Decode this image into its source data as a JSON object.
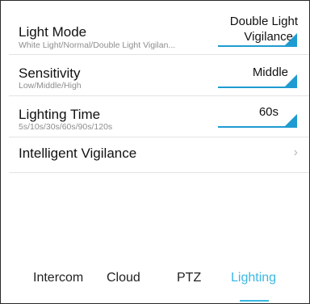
{
  "settings": {
    "light_mode": {
      "title": "Light Mode",
      "subtitle": "White Light/Normal/Double Light Vigilan...",
      "value_line1": "Double Light",
      "value_line2": "Vigilance"
    },
    "sensitivity": {
      "title": "Sensitivity",
      "subtitle": "Low/Middle/High",
      "value": "Middle"
    },
    "lighting_time": {
      "title": "Lighting Time",
      "subtitle": "5s/10s/30s/60s/90s/120s",
      "value": "60s"
    },
    "intelligent_vigilance": {
      "title": "Intelligent Vigilance",
      "chevron": "›"
    }
  },
  "tabs": [
    {
      "label": "Intercom",
      "active": false
    },
    {
      "label": "Cloud",
      "active": false
    },
    {
      "label": "PTZ",
      "active": false
    },
    {
      "label": "Lighting",
      "active": true
    }
  ],
  "colors": {
    "accent": "#3bb8e3",
    "dropdown_fill": "#1e9bd1",
    "text": "#111111",
    "subtext": "#8e8e8e",
    "divider": "#e3e3e3"
  },
  "icons": {
    "dropdown": "dropdown-triangle-icon",
    "chevron": "chevron-right-icon"
  }
}
